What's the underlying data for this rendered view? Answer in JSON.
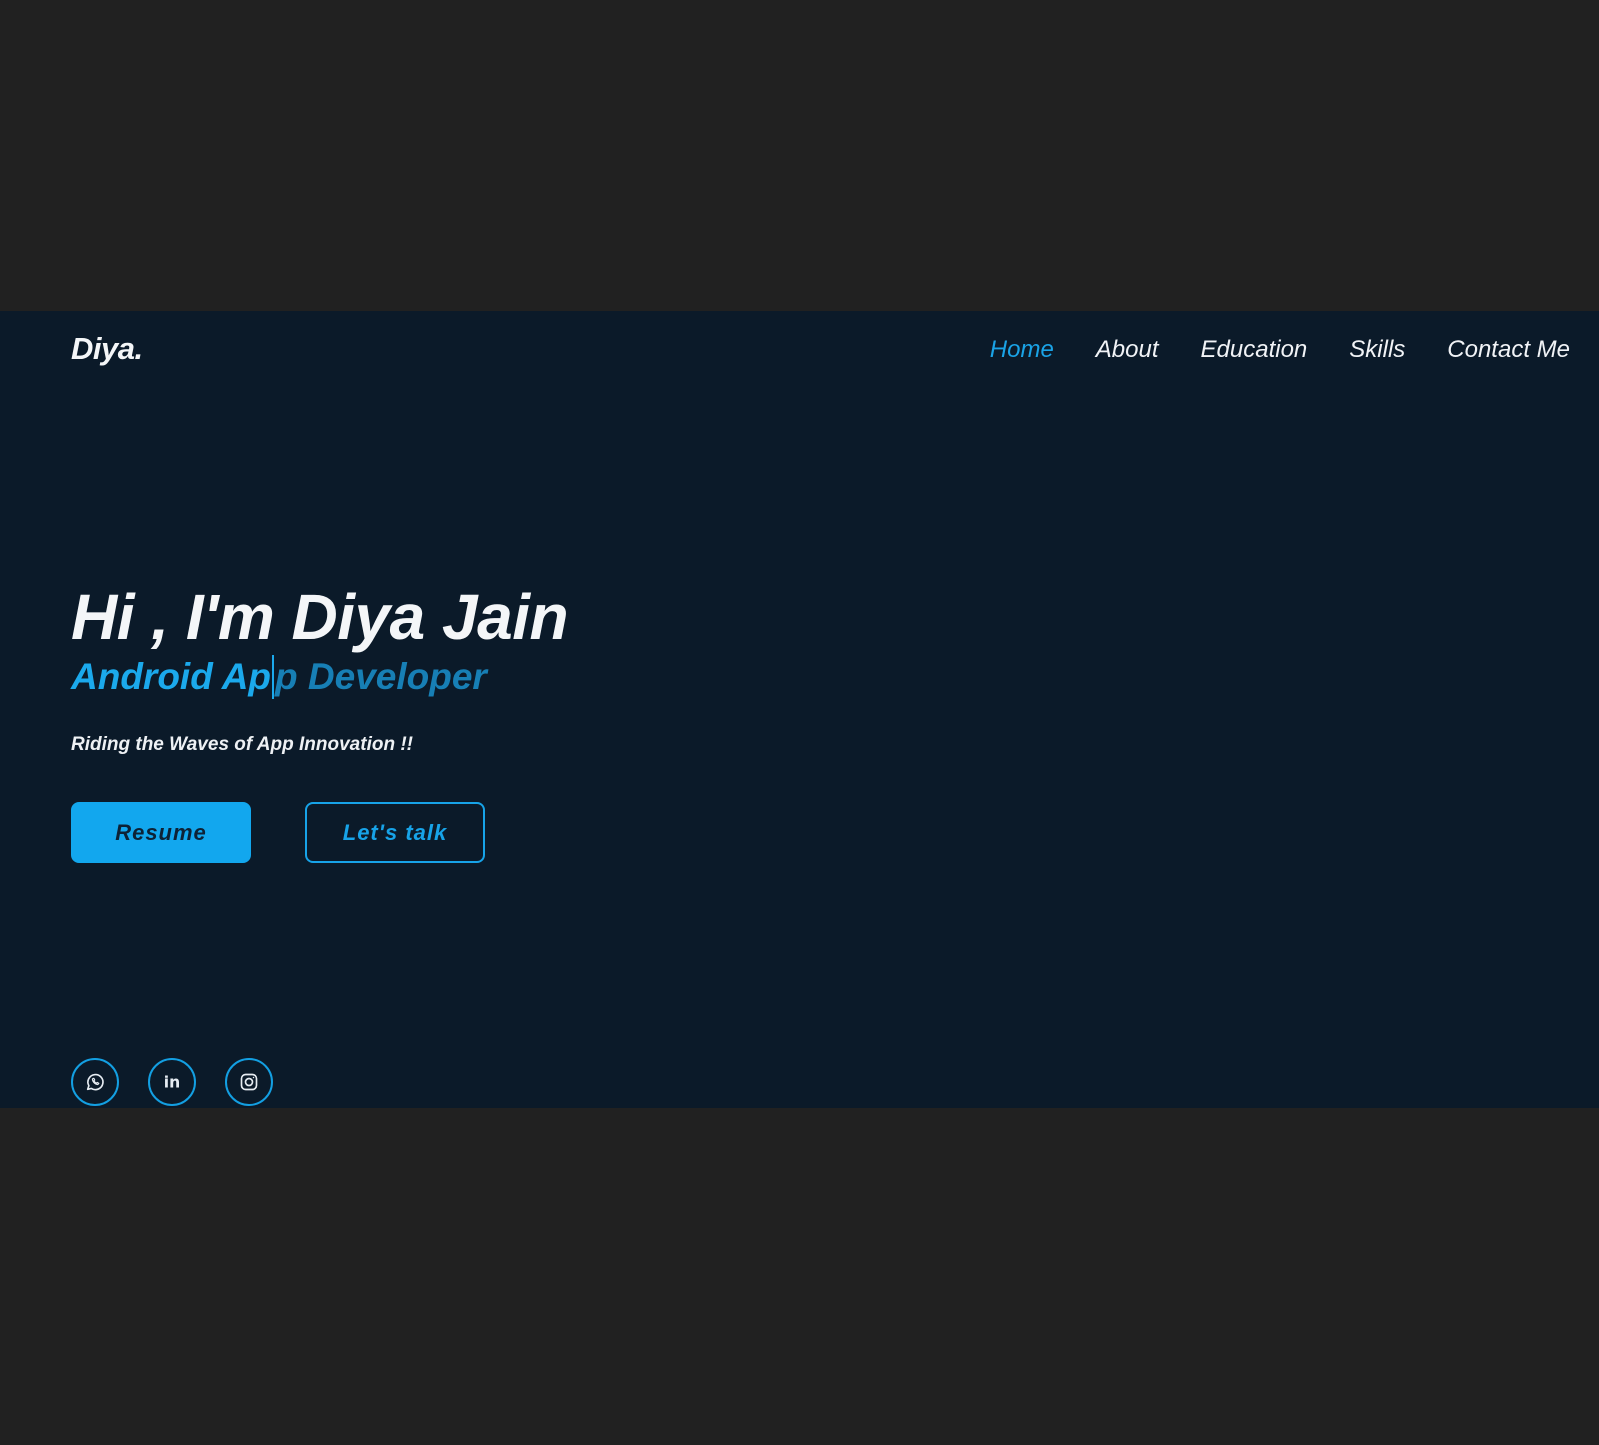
{
  "navbar": {
    "logo": "Diya.",
    "links": [
      {
        "label": "Home",
        "active": true
      },
      {
        "label": "About",
        "active": false
      },
      {
        "label": "Education",
        "active": false
      },
      {
        "label": "Skills",
        "active": false
      },
      {
        "label": "Contact Me",
        "active": false
      }
    ]
  },
  "hero": {
    "title": "Hi , I'm Diya Jain",
    "role_typed": "Android Ap",
    "role_pending": "p Developer",
    "tagline": "Riding the Waves of App Innovation !!",
    "primary_button": "Resume",
    "secondary_button": "Let's talk"
  },
  "socials": [
    {
      "name": "whatsapp-icon",
      "label": "WhatsApp"
    },
    {
      "name": "linkedin-icon",
      "label": "in"
    },
    {
      "name": "instagram-icon",
      "label": "Instagram"
    }
  ],
  "colors": {
    "page_background": "#212121",
    "section_background": "#0b1a29",
    "accent": "#12a7ee",
    "text": "#f4f6f8"
  }
}
